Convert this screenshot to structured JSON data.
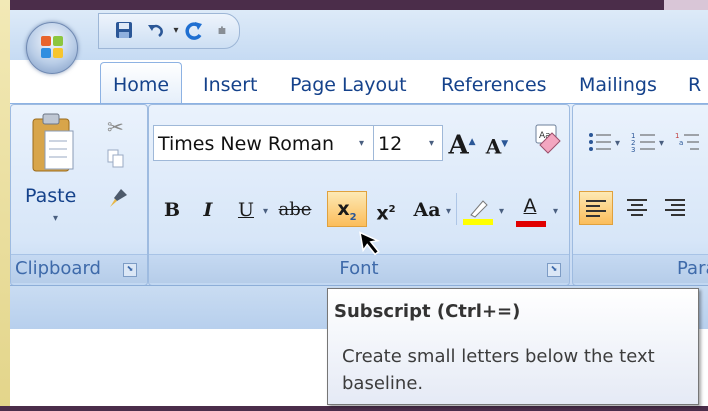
{
  "qat": {
    "save_icon": "save-icon",
    "undo_icon": "undo-icon",
    "redo_icon": "redo-icon",
    "customize_icon": "customize-qat-icon"
  },
  "tabs": [
    {
      "label": "Home"
    },
    {
      "label": "Insert"
    },
    {
      "label": "Page Layout"
    },
    {
      "label": "References"
    },
    {
      "label": "Mailings"
    },
    {
      "label": "R"
    }
  ],
  "clipboard": {
    "paste_label": "Paste",
    "group_label": "Clipboard",
    "cut_icon": "scissors-icon",
    "copy_icon": "copy-icon",
    "format_painter_icon": "format-painter-icon"
  },
  "font": {
    "font_name": "Times New Roman",
    "font_size": "12",
    "grow_label": "A",
    "shrink_label": "A",
    "bold_label": "B",
    "italic_label": "I",
    "underline_label": "U",
    "strike_label": "abe",
    "subscript_label": "x",
    "subscript_small": "2",
    "superscript_label": "x",
    "superscript_small": "2",
    "change_case_label": "Aa",
    "font_color_label": "A",
    "group_label": "Font"
  },
  "paragraph": {
    "group_label": "Para"
  },
  "colors": {
    "highlight": "#ffff00",
    "font_color": "#e00000",
    "subscript_hover": "#fbbd5b"
  },
  "tooltip": {
    "title": "Subscript (Ctrl+=)",
    "body": "Create small letters below the text baseline."
  }
}
